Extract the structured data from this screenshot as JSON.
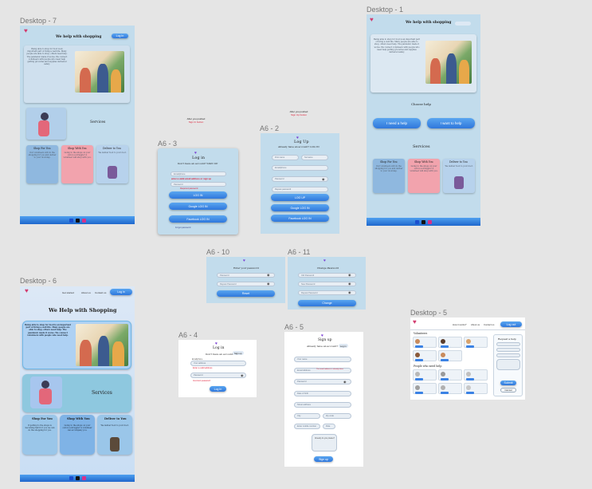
{
  "frame_labels": {
    "d7": "Desktop - 7",
    "d1": "Desktop - 1",
    "d6": "Desktop - 6",
    "d5": "Desktop - 5",
    "a63": "A6 - 3",
    "a62": "A6 - 2",
    "a610": "A6 - 10",
    "a611": "A6 - 11",
    "a64": "A6 - 4",
    "a65": "A6 - 5"
  },
  "annotations": {
    "login_note": "After you pushed",
    "login_link": "Sign In button",
    "signup_note": "After you pushed",
    "signup_link": "Sign Up button"
  },
  "desktop7": {
    "title": "We help with shopping",
    "login_button": "Log In",
    "services": "Services",
    "cards": [
      "Shop For You",
      "Shop With You",
      "Deliver to You"
    ]
  },
  "desktop1": {
    "title": "We help with shopping",
    "choose_help": "Choose help",
    "need_help": "I need a help",
    "want_help": "I want to help",
    "services": "Services",
    "cards": [
      "Shop For You",
      "Shop With You",
      "Deliver to You"
    ]
  },
  "desktop6": {
    "nav": [
      "Get started",
      "About us",
      "Contact us"
    ],
    "login_button": "Log in",
    "title": "We Help with Shopping",
    "services": "Services",
    "cards": [
      "Shop For You",
      "Shop With You",
      "Deliver to You"
    ]
  },
  "desktop5": {
    "nav": [
      "How it works?",
      "About us",
      "Contact us"
    ],
    "login_button": "Log out",
    "volunteers": "Volunteers",
    "people_need_help": "People who need help",
    "request_help": "Request a help",
    "submit": "Submit",
    "cancel": "Cancel"
  },
  "a63": {
    "title": "Log in",
    "subtitle": "Don't have an account? SIGN UP",
    "email": "Email/phone",
    "error": "enter a valid email address or sign up",
    "password": "Password",
    "pw_error": "Required password",
    "login": "LOG IN",
    "google": "Google LOG IN",
    "facebook": "Facebook LOG IN",
    "forgot": "Forgot password"
  },
  "a62": {
    "title": "Log Up",
    "subtitle": "Already have an account? LOG IN",
    "first": "First name",
    "last": "Surname",
    "email": "Email/phone",
    "password": "Password",
    "repeat": "Repeat password",
    "login": "LOG UP",
    "google": "Google LOG IN",
    "facebook": "Facebook LOG IN"
  },
  "a610": {
    "title": "Enter your password",
    "pw": "Password",
    "repeat": "Repeat Password",
    "reset": "Reset"
  },
  "a611": {
    "title": "Change Password",
    "old": "Old Password",
    "new": "New Password",
    "repeat": "Repeat Password",
    "change": "Change"
  },
  "a64": {
    "title": "Log in",
    "subtitle": "Don't have an account?",
    "signup": "Sign up",
    "email_label": "Email/phone",
    "email": "Your address",
    "error": "Enter a valid address",
    "password": "Password",
    "pw_error": "Incorrect password",
    "login": "Log In"
  },
  "a65": {
    "title": "Sign up",
    "subtitle": "Already have an account?",
    "login": "Log in",
    "name": "Your name",
    "email": "Email Address",
    "email_err": "The email address is already taken",
    "password": "Password",
    "dob": "Date of birth",
    "address": "Street address",
    "city": "City",
    "zip": "Zip code",
    "phone": "Enter mobile number",
    "role": "Role",
    "prompt": "Already do you please?",
    "submit": "Sign up"
  }
}
